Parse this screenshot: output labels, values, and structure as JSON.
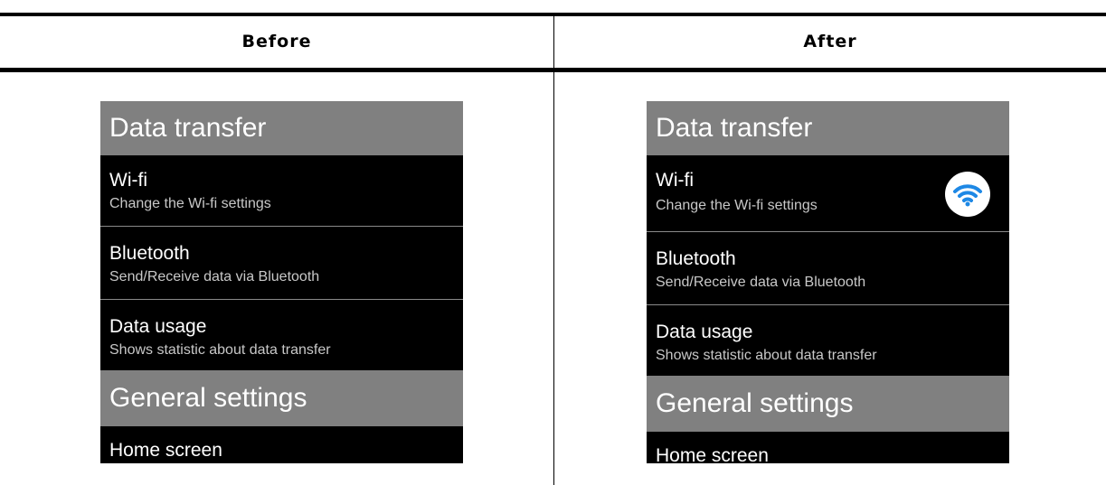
{
  "columns": {
    "before_label": "Before",
    "after_label": "After"
  },
  "list": {
    "section_data_transfer": "Data transfer",
    "wifi_title": "Wi-fi",
    "wifi_desc": "Change the Wi-fi settings",
    "bluetooth_title": "Bluetooth",
    "bluetooth_desc": "Send/Receive data via Bluetooth",
    "data_usage_title": "Data usage",
    "data_usage_desc": "Shows statistic about data transfer",
    "section_general_settings": "General settings",
    "home_screen_title": "Home screen"
  },
  "icons": {
    "wifi": "wifi-icon"
  },
  "colors": {
    "screen_background": "#000000",
    "section_header": "#808080",
    "wifi_icon": "#1e88e5",
    "wifi_badge_background": "#ffffff"
  }
}
